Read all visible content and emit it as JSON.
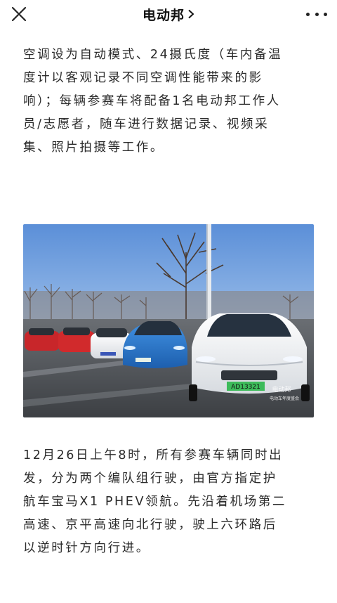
{
  "header": {
    "title": "电动邦",
    "close_icon": "close-icon",
    "more_icon": "more-dots-icon",
    "chevron_icon": "chevron-right-icon"
  },
  "article": {
    "paragraph1_lines": [
      "空调设为自动模式、24摄氏度（车内备温",
      "度计以客观记录不同空调性能带来的影",
      "响）；每辆参赛车将配备1名电动邦工作人",
      "员/志愿者，随车进行数据记录、视频采",
      "集、照片拍摄等工作。"
    ],
    "photo": {
      "plate_text": "AD13321",
      "watermark_line1": "电动邦",
      "watermark_line2": "电动车年度盛会"
    },
    "paragraph2_lines": [
      "12月26日上午8时，所有参赛车辆同时出",
      "发，分为两个编队组行驶，由官方指定护",
      "航车宝马X1 PHEV领航。先沿着机场第二",
      "高速、京平高速向北行驶，驶上六环路后",
      "以逆时针方向行进。"
    ]
  }
}
